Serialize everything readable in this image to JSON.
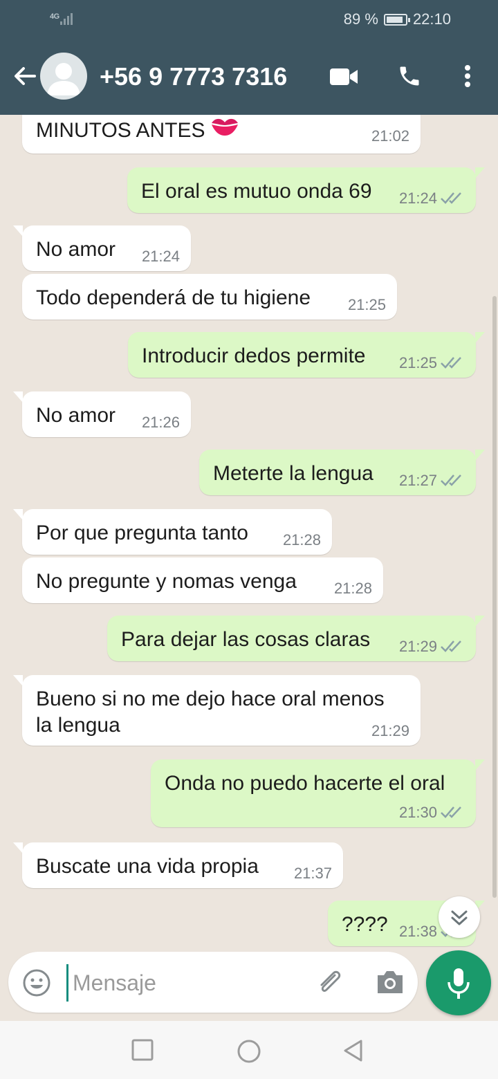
{
  "status_bar": {
    "network": "4G",
    "battery_percent_text": "89 %",
    "battery_level": 0.89,
    "time": "22:10"
  },
  "header": {
    "contact": "+56 9 7773 7316",
    "back_icon": "arrow-left-icon",
    "video_icon": "video-call-icon",
    "call_icon": "phone-icon",
    "menu_icon": "more-vert-icon"
  },
  "messages": [
    {
      "dir": "in",
      "text": "MINUTOS ANTES",
      "emoji": "kiss-mark-icon",
      "time": "21:02"
    },
    {
      "dir": "out",
      "text": "El oral es mutuo onda 69",
      "time": "21:24",
      "status": "read"
    },
    {
      "dir": "in",
      "text": "No amor",
      "time": "21:24"
    },
    {
      "dir": "in",
      "text": "Todo dependerá de tu higiene",
      "time": "21:25"
    },
    {
      "dir": "out",
      "text": "Introducir dedos permite",
      "time": "21:25",
      "status": "read"
    },
    {
      "dir": "in",
      "text": "No amor",
      "time": "21:26"
    },
    {
      "dir": "out",
      "text": "Meterte la lengua",
      "time": "21:27",
      "status": "read"
    },
    {
      "dir": "in",
      "text": "Por que pregunta tanto",
      "time": "21:28"
    },
    {
      "dir": "in",
      "text": "No pregunte y nomas venga",
      "time": "21:28"
    },
    {
      "dir": "out",
      "text": "Para dejar las cosas claras",
      "time": "21:29",
      "status": "read"
    },
    {
      "dir": "in",
      "text": "Bueno si no me dejo hace oral menos\nla lengua",
      "time": "21:29"
    },
    {
      "dir": "out",
      "text": "Onda no puedo hacerte el oral",
      "time": "21:30",
      "status": "read"
    },
    {
      "dir": "in",
      "text": "Buscate una vida propia",
      "time": "21:37"
    },
    {
      "dir": "out",
      "text": "????",
      "time": "21:38",
      "status": "read"
    }
  ],
  "composer": {
    "placeholder": "Mensaje",
    "emoji_icon": "emoji-icon",
    "attach_icon": "paperclip-icon",
    "camera_icon": "camera-icon",
    "mic_icon": "microphone-icon"
  },
  "scroll_fab_icon": "chevron-double-down-icon",
  "colors": {
    "header": "#3d5561",
    "outgoing": "#dcf8c6",
    "incoming": "#ffffff",
    "accent": "#1a9a6b",
    "read_ticks": "#8aa1a8"
  }
}
